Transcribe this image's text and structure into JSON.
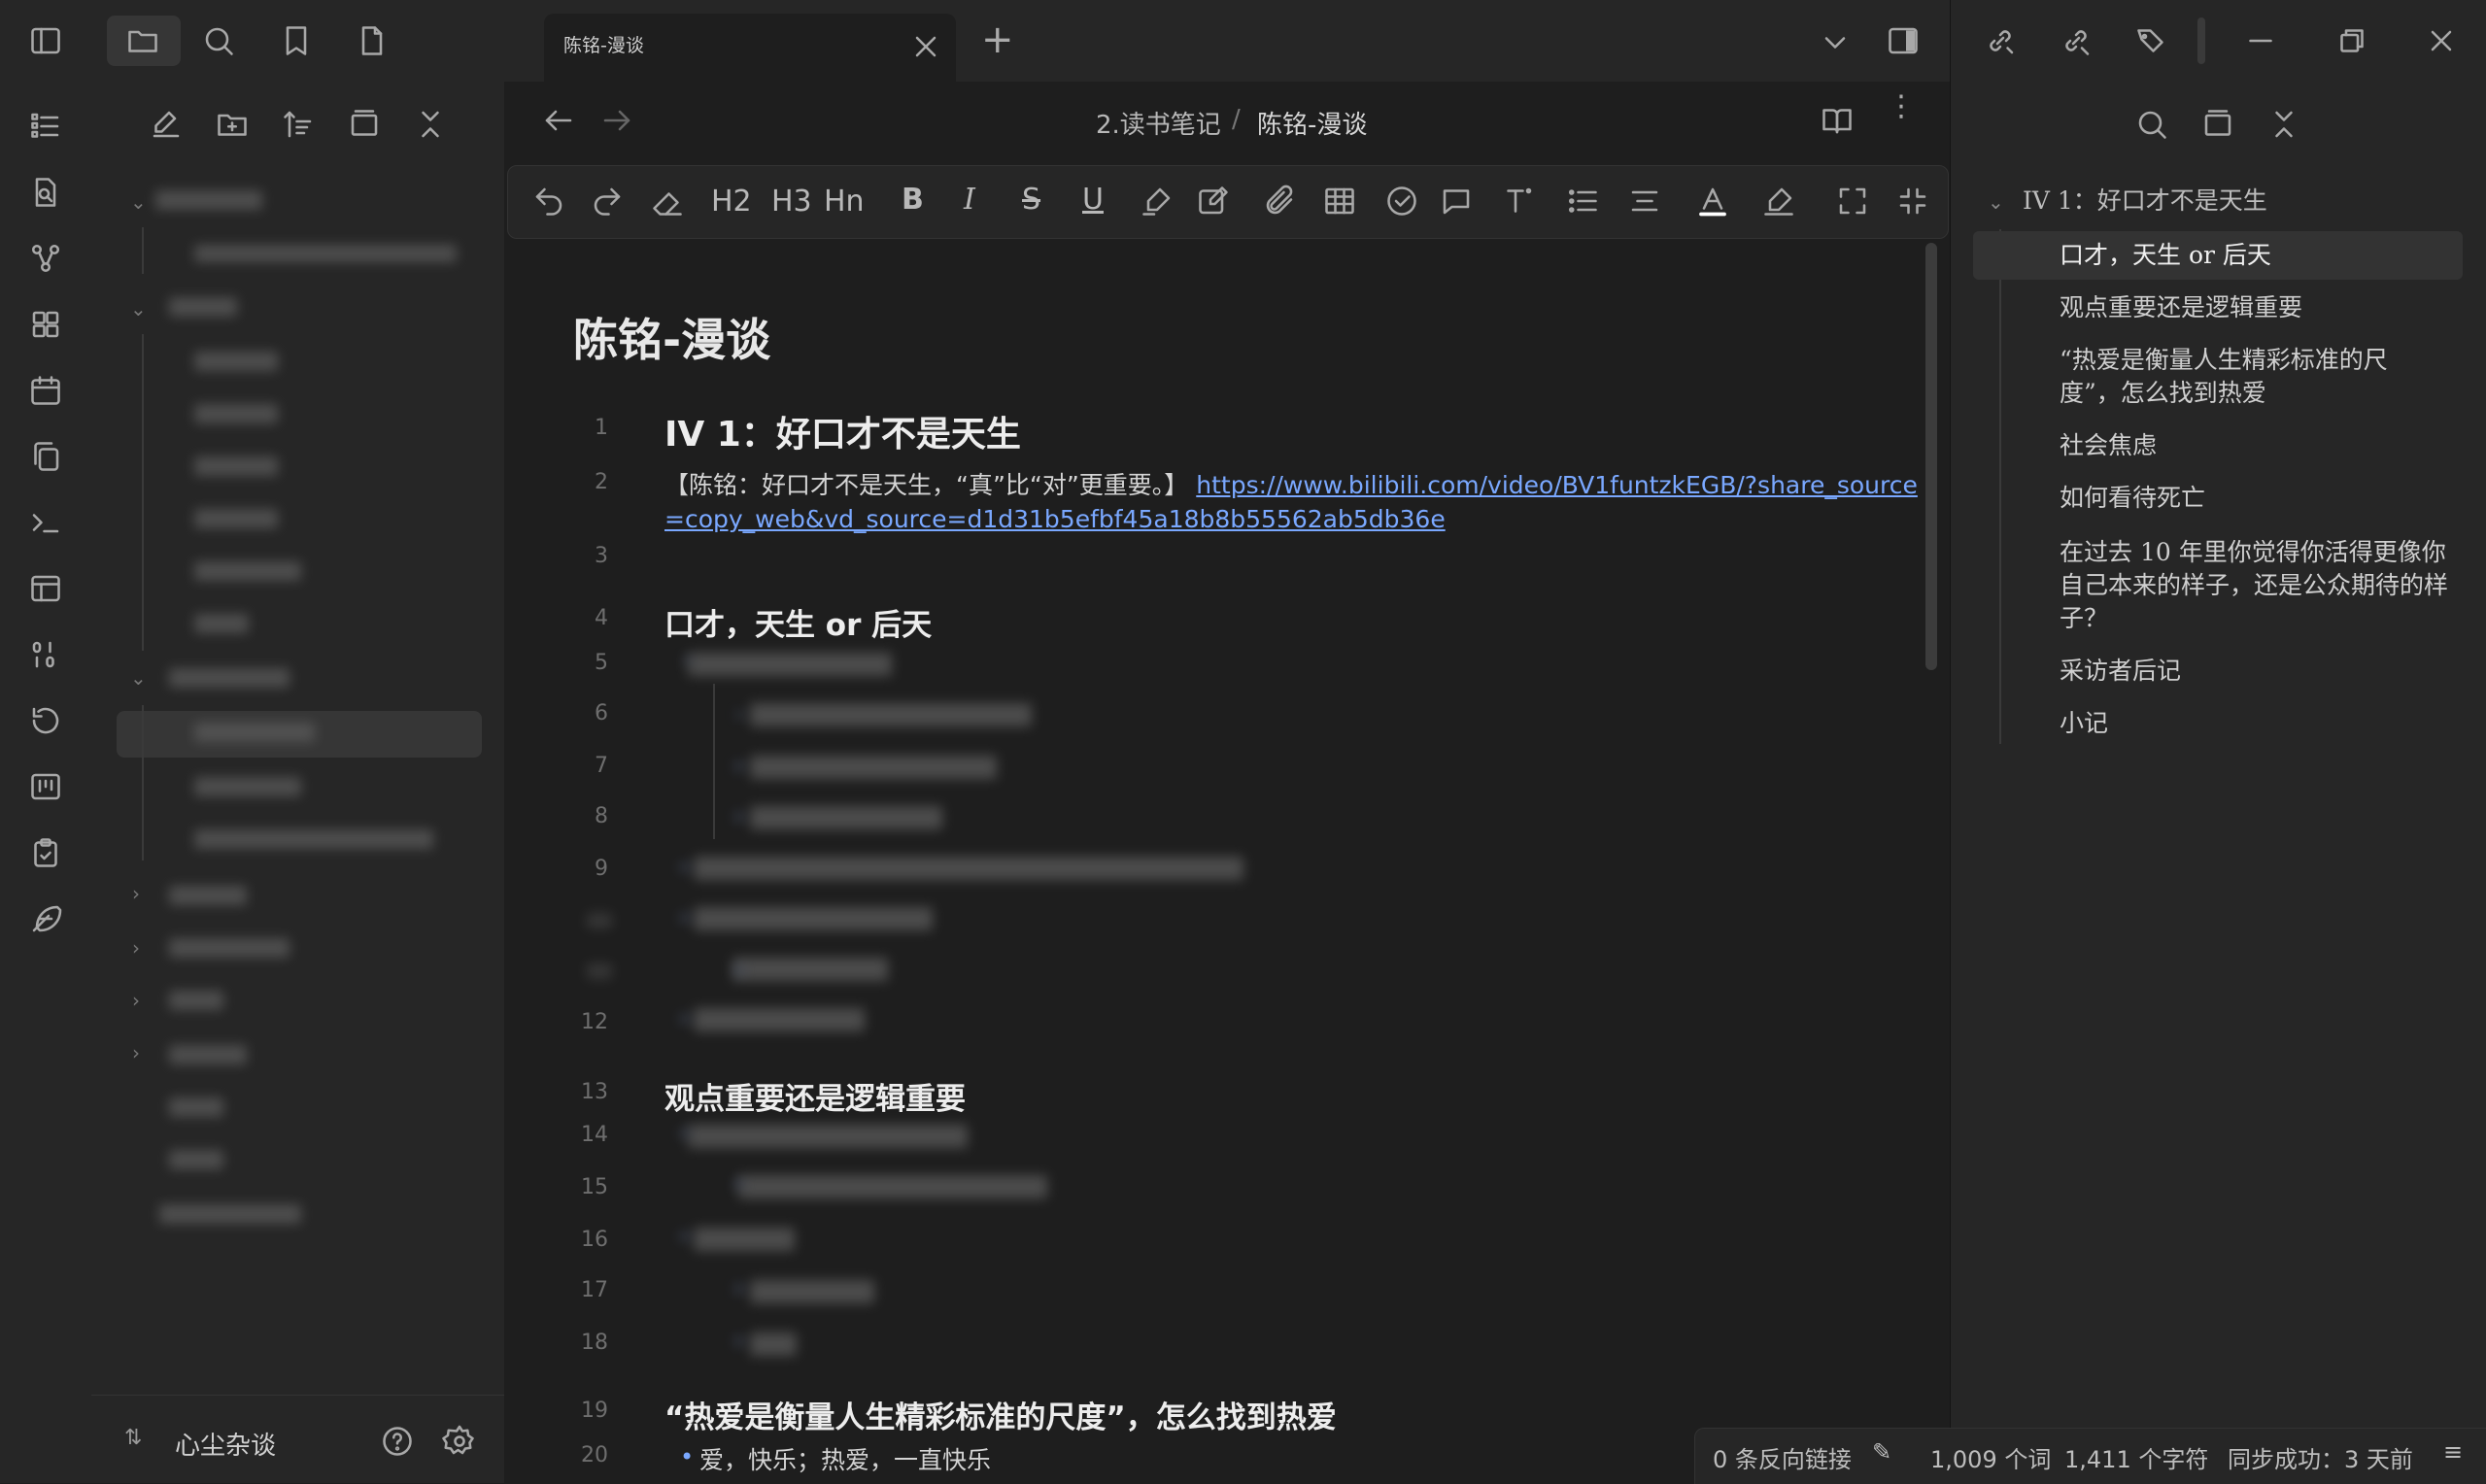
{
  "tab": {
    "title": "陈铭-漫谈",
    "new_tab": "+"
  },
  "breadcrumb": {
    "folder": "2.读书笔记",
    "sep": "/",
    "file": "陈铭-漫谈"
  },
  "toolbar": {
    "h2": "H2",
    "h3": "H3",
    "hn": "Hn",
    "bold": "B",
    "italic": "I",
    "strike": "S",
    "underline": "U"
  },
  "doc": {
    "title": "陈铭-漫谈",
    "line_numbers": [
      "1",
      "2",
      "3",
      "4",
      "5",
      "6",
      "7",
      "8",
      "9",
      "12",
      "13",
      "14",
      "15",
      "16",
      "17",
      "18",
      "19",
      "20"
    ],
    "h1": "IV 1：好口才不是天生",
    "line2_text": "【陈铭：好口才不是天生，“真”比“对”更重要。】",
    "line2_link_a": "https://www.bilibili.com/video/BV1funtzkEGB/?share_source",
    "line2_link_b": "=copy_web&vd_source=d1d31b5efbf45a18b8b55562ab5db36e",
    "h_talent": "口才，天生 or 后天",
    "h_view": "观点重要还是逻辑重要",
    "h_love": "“热爱是衡量人生精彩标准的尺度”，怎么找到热爱",
    "line20": "爱，快乐；热爱，一直快乐"
  },
  "outline": {
    "root": "IV 1：好口才不是天生",
    "items": [
      "口才，天生 or 后天",
      "观点重要还是逻辑重要",
      "“热爱是衡量人生精彩标准的尺度”，怎么找到热爱",
      "社会焦虑",
      "如何看待死亡",
      "在过去 10 年里你觉得你活得更像你自己本来的样子，还是公众期待的样子？",
      "采访者后记",
      "小记"
    ]
  },
  "vault": {
    "name": "心尘杂谈"
  },
  "status": {
    "backlinks": "0 条反向链接",
    "words": "1,009 个词",
    "chars": "1,411 个字符",
    "sync": "同步成功：3 天前"
  },
  "colors": {
    "accent": "#7aa8ff",
    "bg": "#1e1e1e",
    "panel": "#262626"
  }
}
